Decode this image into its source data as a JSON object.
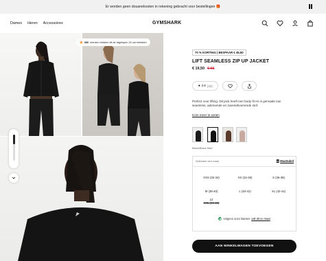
{
  "banner": {
    "text": "Er worden geen douanekosten in rekening gebracht voor bestellingen 🎁"
  },
  "header": {
    "nav": [
      "Dames",
      "Heren",
      "Accessoires"
    ],
    "logo": "GYMSHARK",
    "icons": [
      "search-icon",
      "heart-icon",
      "user-icon",
      "bag-icon"
    ]
  },
  "gallery": {
    "urgency_count": "380",
    "urgency_text": "mensen hebben dit de afgelopen 24 uur bekeken"
  },
  "product": {
    "badge": "70 % KORTING | BESPAAR € 45,50",
    "title": "LIFT SEAMLESS ZIP UP JACKET",
    "price_now": "€ 19,50",
    "price_was": "€ 65",
    "rating_value": "★ 3.8",
    "rating_count": "(32)",
    "description": "Perfect voor lifting. Dit jack heeft een body fit en is gemaakt van seamless, ademende en zweetafvoerende stof.",
    "read_more": "Kom meer te weten",
    "color_label": "Black/Black Marl",
    "swatches": [
      {
        "color": "#1a1a1a",
        "bg": "#eeeeee"
      },
      {
        "color": "#111111",
        "bg": "#f4f4f4"
      },
      {
        "color": "#5a3a2a",
        "bg": "#eae6e2"
      },
      {
        "color": "#c8a9a0",
        "bg": "#eeeeee"
      },
      {
        "color": "#7f8fa8",
        "bg": "#eeeeee"
      }
    ]
  },
  "sizes": {
    "header": "Selecteer een maat",
    "size_table": "Maattabel",
    "options": [
      {
        "label": "XXS (32-34)"
      },
      {
        "label": "XS (34-36)"
      },
      {
        "label": "S (36-38)"
      },
      {
        "label": "M (38-40)"
      },
      {
        "label": "L (40-42)"
      },
      {
        "label": "XL (42-44)"
      },
      {
        "label": "12",
        "sub": "XXL (44-46)"
      }
    ],
    "fit_text": "Volgens onze klanten",
    "fit_link": "valt dit so maat"
  },
  "cart_button": "AAN WINKELWAGEN TOEVOEGEN",
  "colors": {
    "sale": "#d0021b",
    "button": "#111111",
    "fit_ok": "#2e9e5b"
  }
}
